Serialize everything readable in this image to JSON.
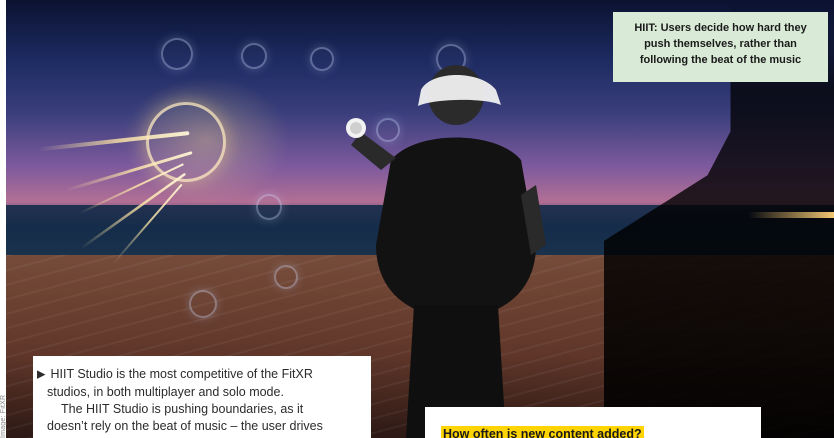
{
  "figure": {
    "caption_text": "HIIT: Users decide how hard they push themselves, rather than following the beat of the music",
    "credit_text": "Image: FitXR"
  },
  "article": {
    "line_1": "HIIT Studio is the most competitive of the FitXR",
    "line_2": "studios, in both multiplayer and solo mode.",
    "line_3": "The HIIT Studio is pushing boundaries, as it",
    "line_4": "doesn’t rely on the beat of music – the user drives"
  },
  "qa": {
    "question": "How often is new content added?"
  },
  "colors": {
    "caption_bg": "#d9ead7",
    "highlight_yellow": "#ffd400",
    "text_dark": "#1b1b1b"
  }
}
